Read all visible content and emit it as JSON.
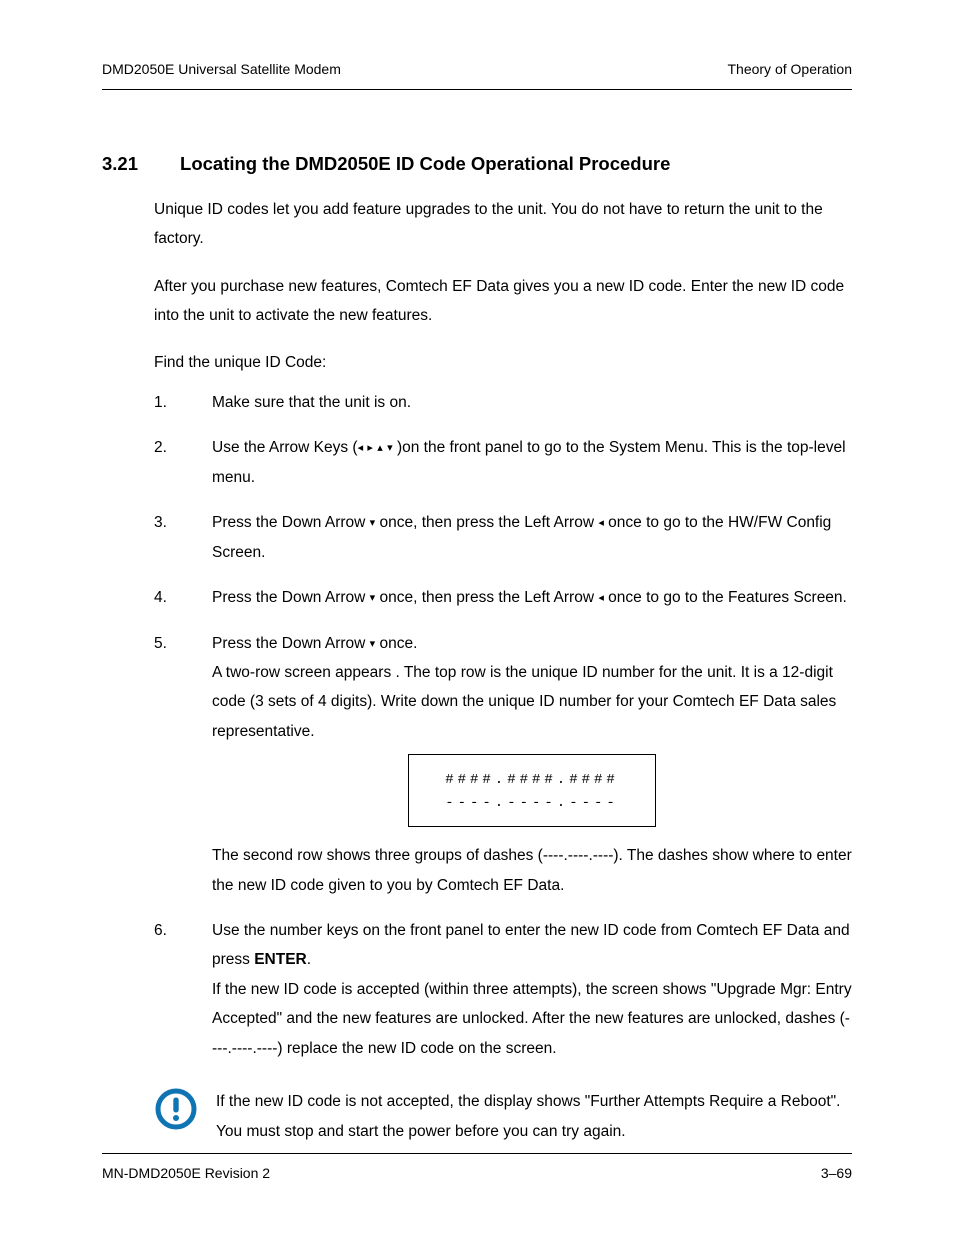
{
  "header": {
    "left": "DMD2050E Universal Satellite Modem",
    "right": "Theory of Operation"
  },
  "section": {
    "number": "3.21",
    "title": "Locating the DMD2050E ID Code Operational Procedure"
  },
  "intro": {
    "p1": "Unique ID codes let you add feature upgrades to the unit. You do not have to return the unit to the factory.",
    "p2": "After you purchase new features, Comtech EF Data gives you a new ID code. Enter the new ID code into the unit to activate the new features.",
    "p3": "Find the unique ID Code:"
  },
  "steps": {
    "s1": "Make sure that the unit is on.",
    "s2a": "Use the Arrow Keys (",
    "s2b": ")on the front panel to go to the System Menu.  This is the top-level menu.",
    "s3a": "Press the Down Arrow ",
    "s3b": " once, then press the Left Arrow ",
    "s3c": " once to go to the HW/FW Config Screen.",
    "s4a": "Press the Down Arrow ",
    "s4b": " once, then press the Left Arrow ",
    "s4c": " once to go to the Features Screen.",
    "s5a": "Press the Down Arrow ",
    "s5b": " once.",
    "s5c": "A two-row screen appears .  The top row is the unique ID number for the unit.  It is a 12-digit code (3 sets of 4 digits).  Write down the unique ID number for your Comtech EF Data  sales representative.",
    "lcd_line1": "####.####.####",
    "lcd_line2": "----.----.----",
    "s5d": "The second row shows three groups of dashes (----.----.----).  The dashes show where to enter the new ID code given to you by Comtech EF Data.",
    "s6a": "Use the number keys on the front panel to enter the new ID code from Comtech EF Data and press ",
    "s6_enter": "ENTER",
    "s6b": ".",
    "s6c": "If the new ID code is accepted (within three attempts), the screen shows \"Upgrade Mgr: Entry Accepted\" and the new features are unlocked. After the new features are unlocked, dashes (----.----.----) replace the new ID code on the screen."
  },
  "note": "If the new ID code is not accepted,  the display shows \"Further Attempts Require a Reboot\". You must stop and start the power before you can try again.",
  "footer": {
    "left": "MN-DMD2050E   Revision 2",
    "right": "3–69"
  },
  "glyphs": {
    "left": "◂",
    "right": "▸",
    "up": "▴",
    "down": "▾"
  }
}
